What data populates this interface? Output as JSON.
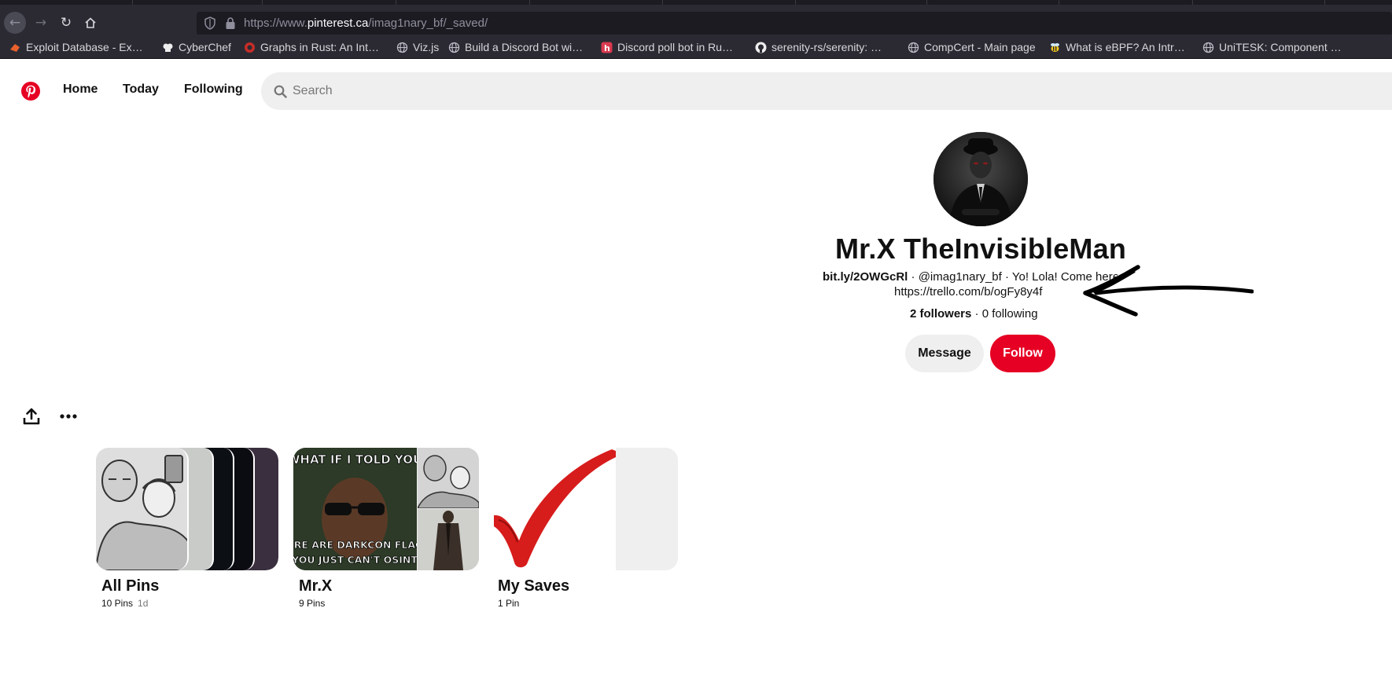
{
  "browser": {
    "url_prefix": "https://www.",
    "url_domain": "pinterest.ca",
    "url_path": "/imag1nary_bf/_saved/",
    "bookmarks": [
      {
        "label": "Exploit Database - Ex…",
        "icon": "exploit-db-icon"
      },
      {
        "label": "CyberChef",
        "icon": "chef-hat-icon"
      },
      {
        "label": "Graphs in Rust: An Int…",
        "icon": "rust-icon"
      },
      {
        "label": "Viz.js",
        "icon": "globe-icon"
      },
      {
        "label": "Build a Discord Bot wi…",
        "icon": "globe-icon"
      },
      {
        "label": "Discord poll bot in Ru…",
        "icon": "h-badge-icon"
      },
      {
        "label": "serenity-rs/serenity: …",
        "icon": "github-icon"
      },
      {
        "label": "CompCert - Main page",
        "icon": "globe-icon"
      },
      {
        "label": "What is eBPF? An Intr…",
        "icon": "bee-icon"
      },
      {
        "label": "UniTESK: Component …",
        "icon": "globe-icon"
      }
    ]
  },
  "header": {
    "nav": [
      "Home",
      "Today",
      "Following"
    ],
    "search_placeholder": "Search"
  },
  "profile": {
    "name": "Mr.X TheInvisibleMan",
    "link": "bit.ly/2OWGcRl",
    "bio_rest": " · @imag1nary_bf · Yo! Lola! Come here",
    "bio_line2": "https://trello.com/b/ogFy8y4f",
    "followers": "2 followers",
    "following": " · 0 following",
    "message_label": "Message",
    "follow_label": "Follow"
  },
  "colors": {
    "brand_red": "#e60023",
    "chrome_dark": "#2b2a33",
    "button_gray": "#efefef"
  },
  "boards": [
    {
      "title": "All Pins",
      "count": "10 Pins",
      "age": "1d"
    },
    {
      "title": "Mr.X",
      "count": "9 Pins",
      "age": ""
    },
    {
      "title": "My Saves",
      "count": "1 Pin",
      "age": ""
    }
  ],
  "pin_texts": {
    "meme_top": "WHAT IF I TOLD YOU",
    "meme_bottom_1": "HERE ARE DARKCON FLAGS",
    "meme_bottom_2": "YOU JUST CAN'T OSINT"
  }
}
